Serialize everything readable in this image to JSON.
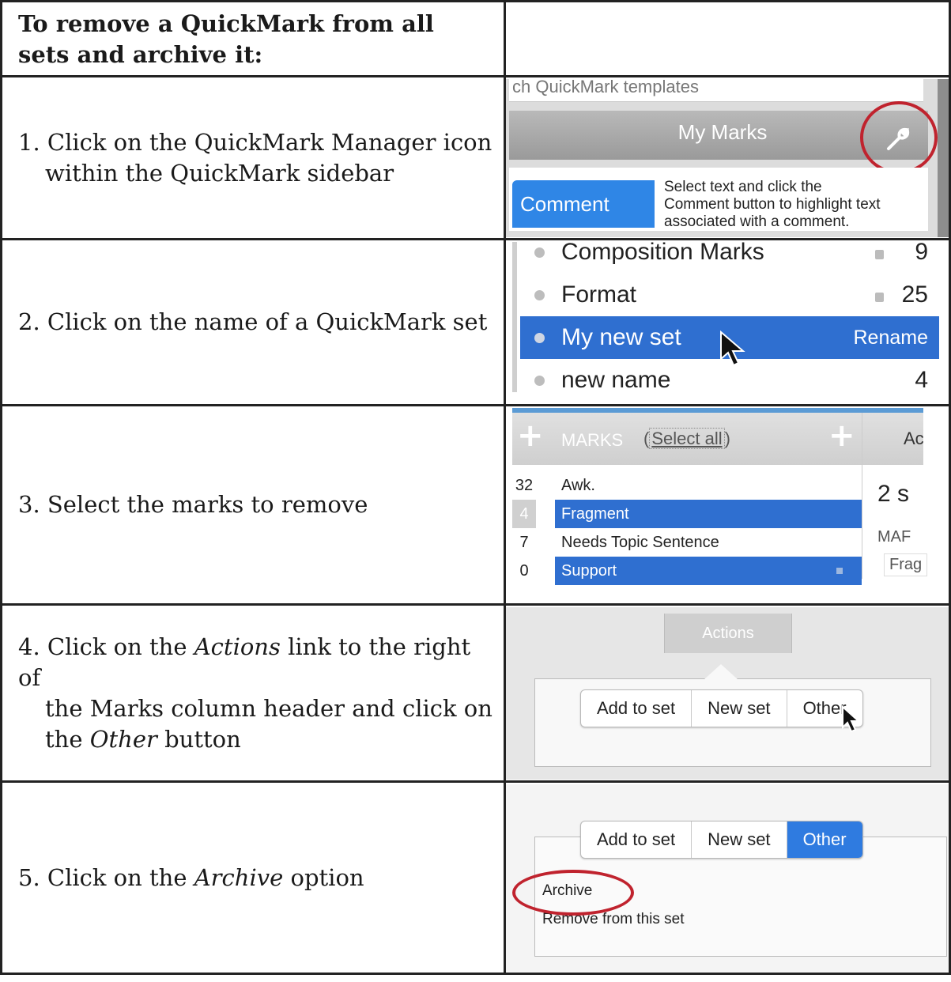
{
  "title": "To remove a QuickMark from all sets and archive it:",
  "steps": [
    {
      "num": "1.",
      "line1": "Click on the QuickMark Manager icon",
      "line2": "within the QuickMark sidebar"
    },
    {
      "num": "2.",
      "line1": "Click on the name of a QuickMark set"
    },
    {
      "num": "3.",
      "line1": "Select the marks to remove"
    },
    {
      "num": "4.",
      "pre": "Click on the ",
      "em1": "Actions",
      "mid": " link to the right of",
      "line2": "the Marks column header and click on",
      "line3pre": "the ",
      "em2": "Other",
      "line3post": " button"
    },
    {
      "num": "5.",
      "pre": "Click on the ",
      "em": "Archive",
      "post": " option"
    }
  ],
  "shot1": {
    "search_text": "ch QuickMark templates",
    "bar_title": "My Marks",
    "comment_button": "Comment",
    "description": [
      "Select text and click the",
      "Comment button to highlight text",
      "associated with a comment."
    ],
    "icon": "wrench-icon"
  },
  "shot2": {
    "rows": [
      {
        "name": "Composition Marks",
        "count": "9"
      },
      {
        "name": "Format",
        "count": "25"
      },
      {
        "name": "My new set",
        "action": "Rename"
      },
      {
        "name": "new name",
        "count": "4"
      }
    ]
  },
  "shot3": {
    "marks_label": "MARKS",
    "select_all": "Select all",
    "actions_partial": "Ac",
    "items": [
      {
        "count": "32",
        "name": "Awk."
      },
      {
        "count": "4",
        "name": "Fragment"
      },
      {
        "count": "7",
        "name": "Needs Topic Sentence"
      },
      {
        "count": "0",
        "name": "Support"
      }
    ],
    "selected_partial": "2 s",
    "mar_partial": "MAF",
    "frag_partial": "Frag"
  },
  "shot4": {
    "actions": "Actions",
    "buttons": [
      "Add to set",
      "New set",
      "Other"
    ]
  },
  "shot5": {
    "buttons": [
      "Add to set",
      "New set",
      "Other"
    ],
    "options": [
      "Archive",
      "Remove from this set"
    ]
  },
  "colors": {
    "highlight_circle": "#c0232e",
    "selection_blue": "#2f6fd0",
    "button_blue": "#2f86e6"
  }
}
